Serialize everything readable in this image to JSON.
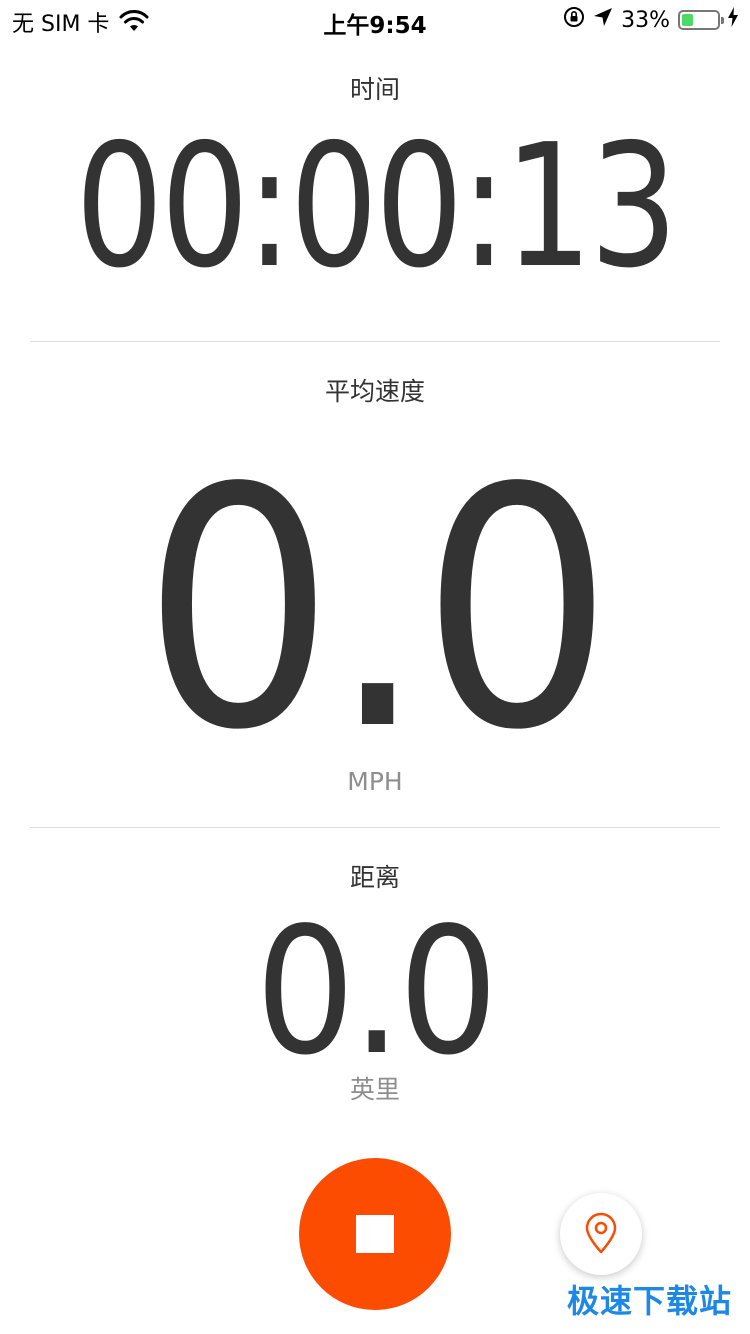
{
  "status_bar": {
    "carrier": "无 SIM 卡",
    "time": "上午9:54",
    "battery_percent": "33%",
    "battery_level": 0.33,
    "icons": [
      "wifi-icon",
      "rotation-lock-icon",
      "location-arrow-icon",
      "battery-icon",
      "charging-bolt-icon"
    ]
  },
  "time_section": {
    "label": "时间",
    "value": "00:00:13"
  },
  "speed_section": {
    "label": "平均速度",
    "value": "0.0",
    "unit": "MPH"
  },
  "distance_section": {
    "label": "距离",
    "value": "0.0",
    "unit": "英里"
  },
  "controls": {
    "stop_icon": "stop-icon",
    "location_icon": "map-pin-icon"
  },
  "watermark": "极速下载站",
  "colors": {
    "accent": "#fc4c02",
    "text": "#333333",
    "unit_text": "#8e8e8e",
    "battery": "#4cd964"
  }
}
